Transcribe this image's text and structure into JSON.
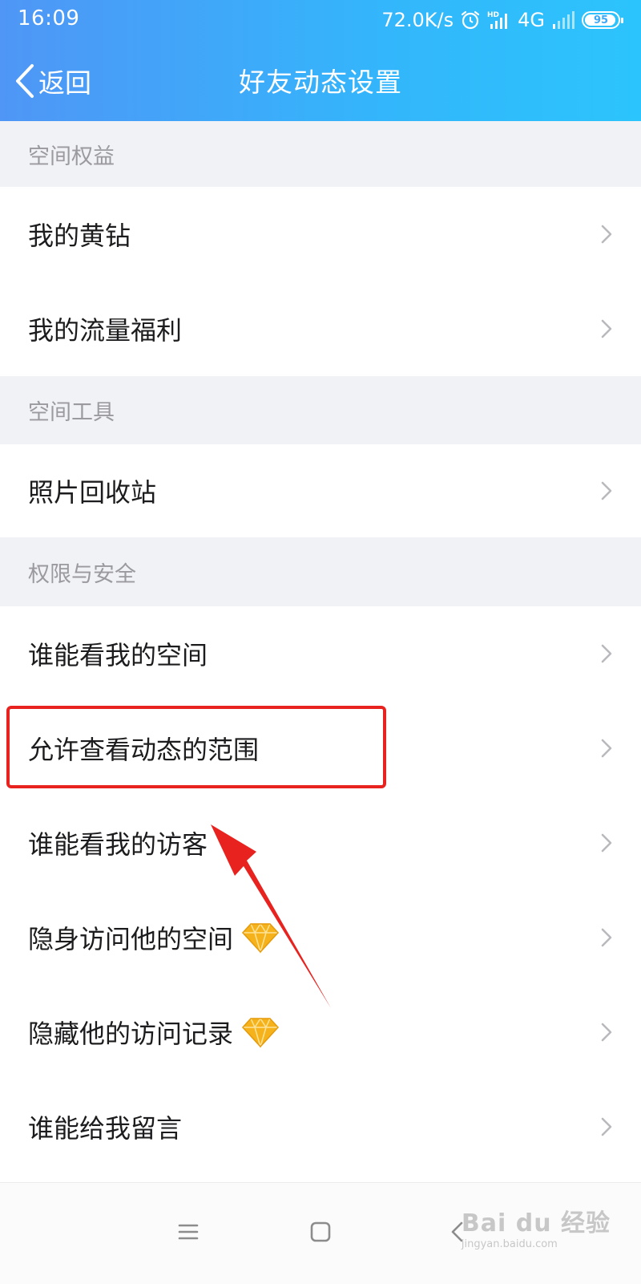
{
  "status_bar": {
    "time": "16:09",
    "speed": "72.0K/s",
    "network": "4G",
    "battery": "95"
  },
  "nav": {
    "back_label": "返回",
    "title": "好友动态设置"
  },
  "sections": [
    {
      "header": "空间权益",
      "items": [
        {
          "label": "我的黄钻"
        },
        {
          "label": "我的流量福利"
        }
      ]
    },
    {
      "header": "空间工具",
      "items": [
        {
          "label": "照片回收站"
        }
      ]
    },
    {
      "header": "权限与安全",
      "items": [
        {
          "label": "谁能看我的空间"
        },
        {
          "label": "允许查看动态的范围",
          "highlighted": true
        },
        {
          "label": "谁能看我的访客"
        },
        {
          "label": "隐身访问他的空间",
          "icon": "yellow-diamond-icon"
        },
        {
          "label": "隐藏他的访问记录",
          "icon": "yellow-diamond-icon"
        },
        {
          "label": "谁能给我留言"
        }
      ]
    }
  ],
  "colors": {
    "header_start": "#4f96f6",
    "header_end": "#2cc4fc",
    "section_bg": "#f1f2f5",
    "highlight": "#e8231f",
    "diamond": "#f6b21b"
  },
  "watermark": {
    "main": "Bai du 经验",
    "sub": "jingyan.baidu.com"
  }
}
